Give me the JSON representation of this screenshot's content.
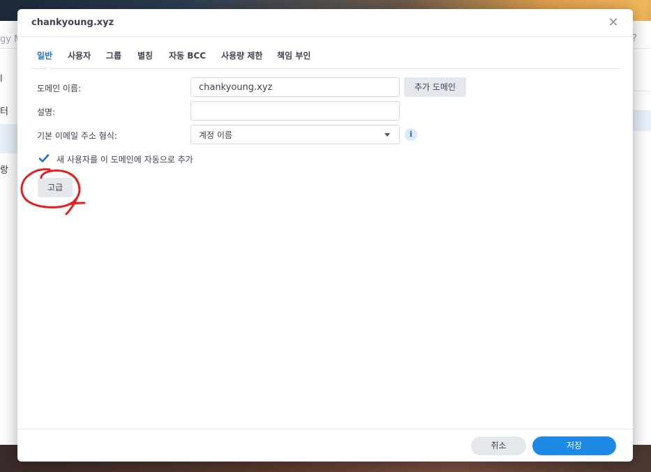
{
  "background": {
    "app_title": "gy M",
    "help_icon": "question-icon",
    "sidebar_fragments": [
      "l",
      "터",
      "랑"
    ]
  },
  "dialog": {
    "title": "chankyoung.xyz",
    "close_icon": "close-icon",
    "tabs": [
      {
        "label": "일반",
        "active": true
      },
      {
        "label": "사용자",
        "active": false
      },
      {
        "label": "그룹",
        "active": false
      },
      {
        "label": "별칭",
        "active": false
      },
      {
        "label": "자동 BCC",
        "active": false
      },
      {
        "label": "사용량 제한",
        "active": false
      },
      {
        "label": "책임 부인",
        "active": false
      }
    ],
    "form": {
      "domain_name_label": "도메인 이름:",
      "domain_name_value": "chankyoung.xyz",
      "add_domain_button": "추가 도메인",
      "description_label": "설명:",
      "description_value": "",
      "email_format_label": "기본 이메일 주소 형식:",
      "email_format_value": "계정 이름",
      "info_icon": "info-icon",
      "auto_add_checkbox_label": "새 사용자를 이 도메인에 자동으로 추가",
      "auto_add_checked": true,
      "advanced_button": "고급"
    },
    "footer": {
      "cancel_label": "취소",
      "save_label": "저장"
    }
  },
  "colors": {
    "accent": "#1e88e5",
    "active_tab": "#1f6fc5",
    "annotation": "#e0201f"
  }
}
